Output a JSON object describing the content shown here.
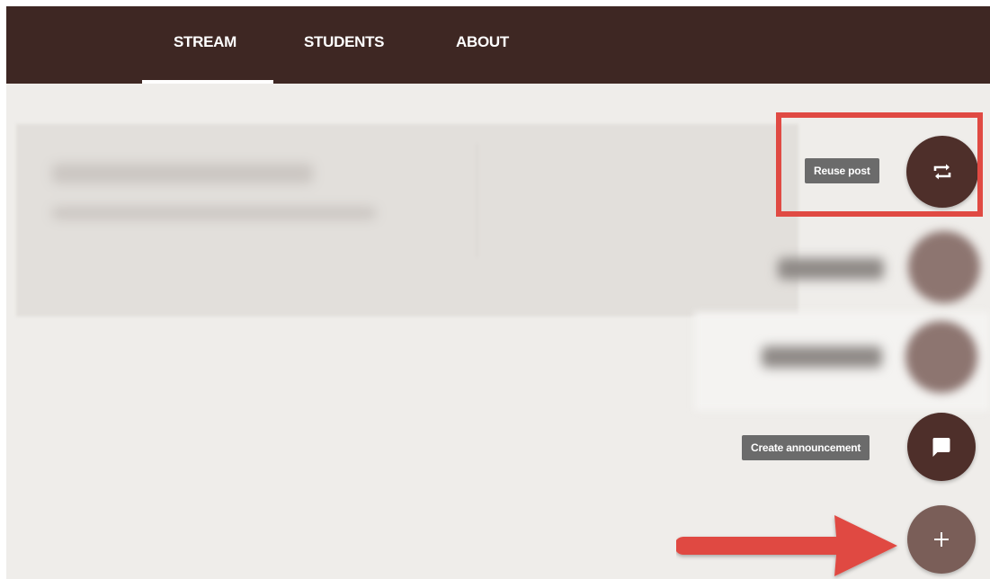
{
  "nav": {
    "tabs": [
      {
        "label": "STREAM",
        "active": true
      },
      {
        "label": "STUDENTS",
        "active": false
      },
      {
        "label": "ABOUT",
        "active": false
      }
    ]
  },
  "speed_dial": {
    "reuse_post": {
      "tooltip": "Reuse post",
      "icon": "repeat-icon"
    },
    "create_announcement": {
      "tooltip": "Create announcement",
      "icon": "comment-icon"
    },
    "main_button": {
      "icon": "plus-icon"
    }
  },
  "colors": {
    "topbar": "#3e2723",
    "background": "#efedea",
    "fab_dark": "#4e2f2a",
    "fab_light": "#7a5e58",
    "highlight": "#e04a43",
    "arrow": "#e04a43"
  }
}
